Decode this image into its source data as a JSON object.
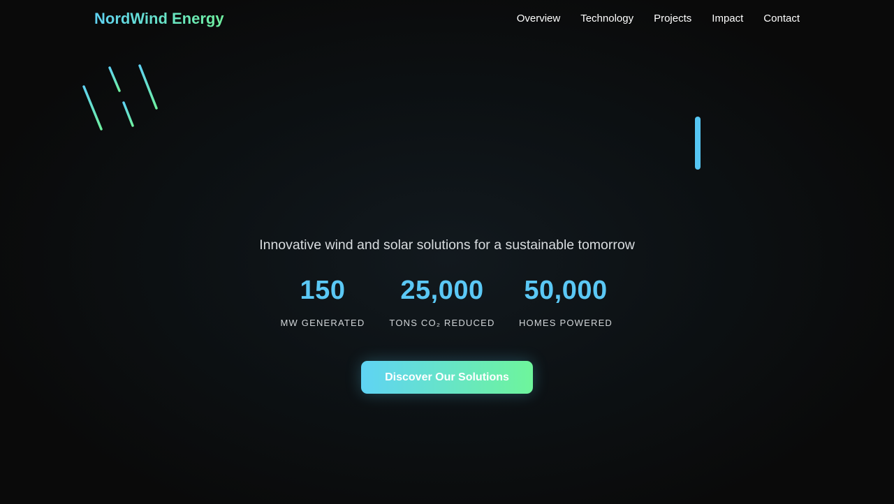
{
  "header": {
    "brand": "NordWind Energy",
    "nav": [
      "Overview",
      "Technology",
      "Projects",
      "Impact",
      "Contact"
    ]
  },
  "hero": {
    "tagline": "Innovative wind and solar solutions for a sustainable tomorrow",
    "stats": [
      {
        "value": "150",
        "label": "MW GENERATED"
      },
      {
        "value": "25,000",
        "label": "TONS CO₂ REDUCED"
      },
      {
        "value": "50,000",
        "label": "HOMES POWERED"
      }
    ],
    "cta_label": "Discover Our Solutions"
  },
  "colors": {
    "background": "#0a0a0a",
    "accent_blue": "#5bc8f5",
    "accent_green": "#6ef59b"
  }
}
